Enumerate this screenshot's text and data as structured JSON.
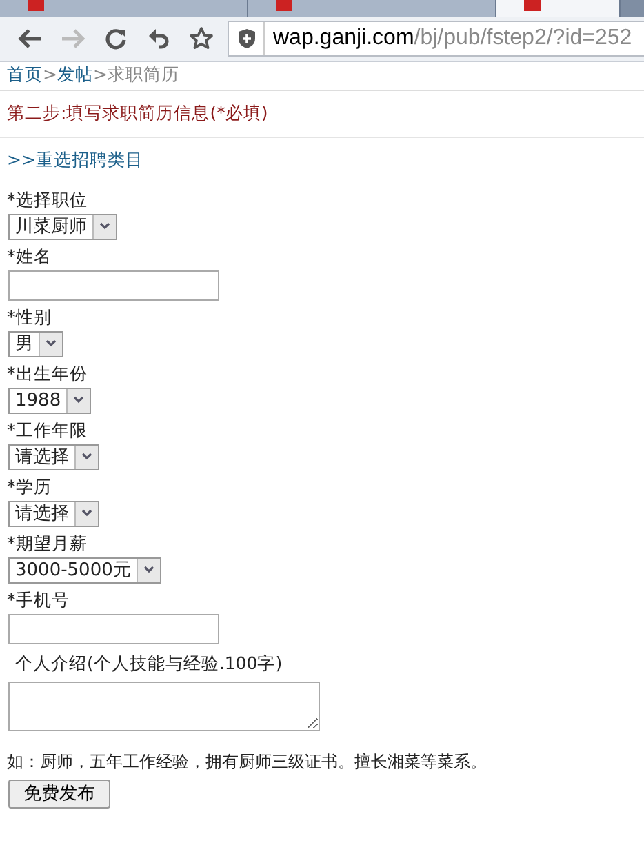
{
  "browser": {
    "tabs": [
      {
        "selected": false
      },
      {
        "selected": false
      },
      {
        "selected": true
      }
    ],
    "url": {
      "host": "wap.ganji.com",
      "path": "/bj/pub/fstep2/?id=252"
    }
  },
  "breadcrumb": [
    {
      "label": "首页",
      "kind": "link"
    },
    {
      "label": ">",
      "kind": "sep"
    },
    {
      "label": "发帖",
      "kind": "link"
    },
    {
      "label": ">求职简历",
      "kind": "text"
    }
  ],
  "step_title": "第二步:填写求职简历信息(*必填)",
  "reselect_link": ">>重选招聘类目",
  "fields": [
    {
      "label": "*选择职位",
      "kind": "select",
      "value": "川菜厨师"
    },
    {
      "label": "*姓名",
      "kind": "input"
    },
    {
      "label": "*性别",
      "kind": "select",
      "value": "男"
    },
    {
      "label": "*出生年份",
      "kind": "select",
      "value": "1988"
    },
    {
      "label": "*工作年限",
      "kind": "select",
      "value": "请选择"
    },
    {
      "label": "*学历",
      "kind": "select",
      "value": "请选择"
    },
    {
      "label": "*期望月薪",
      "kind": "select",
      "value": "3000-5000元"
    },
    {
      "label": "*手机号",
      "kind": "input"
    },
    {
      "label": "个人介绍(个人技能与经验.100字)",
      "kind": "textarea"
    }
  ],
  "example": "如：厨师，五年工作经验，拥有厨师三级证书。擅长湘菜等菜系。",
  "submit": "免费发布"
}
